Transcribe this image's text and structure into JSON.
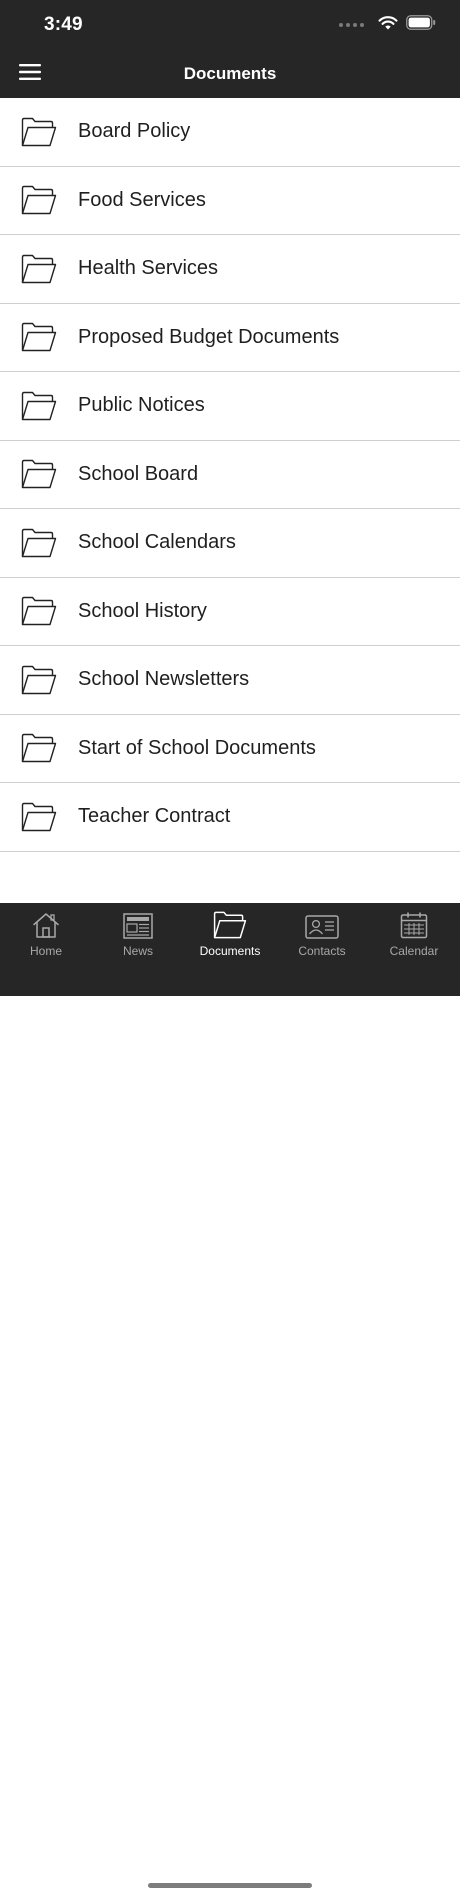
{
  "status_bar": {
    "time": "3:49",
    "icons": [
      "signal-dots-icon",
      "wifi-icon",
      "battery-icon"
    ]
  },
  "header": {
    "title": "Documents",
    "menu_icon": "hamburger-menu-icon"
  },
  "documents": {
    "items": [
      {
        "label": "Board Policy",
        "icon": "folder-icon"
      },
      {
        "label": "Food Services",
        "icon": "folder-icon"
      },
      {
        "label": "Health Services",
        "icon": "folder-icon"
      },
      {
        "label": "Proposed Budget Documents",
        "icon": "folder-icon"
      },
      {
        "label": "Public Notices",
        "icon": "folder-icon"
      },
      {
        "label": "School Board",
        "icon": "folder-icon"
      },
      {
        "label": "School Calendars",
        "icon": "folder-icon"
      },
      {
        "label": "School History",
        "icon": "folder-icon"
      },
      {
        "label": "School Newsletters",
        "icon": "folder-icon"
      },
      {
        "label": "Start of School Documents",
        "icon": "folder-icon"
      },
      {
        "label": "Teacher Contract",
        "icon": "folder-icon"
      }
    ]
  },
  "tab_bar": {
    "tabs": [
      {
        "label": "Home",
        "icon": "home-icon",
        "active": false
      },
      {
        "label": "News",
        "icon": "newspaper-icon",
        "active": false
      },
      {
        "label": "Documents",
        "icon": "folder-icon",
        "active": true
      },
      {
        "label": "Contacts",
        "icon": "contact-card-icon",
        "active": false
      },
      {
        "label": "Calendar",
        "icon": "calendar-icon",
        "active": false
      }
    ]
  },
  "colors": {
    "bar_background": "#262626",
    "active_tab": "#ffffff",
    "inactive_tab": "#a8a8a8",
    "divider": "#cfcfcf"
  }
}
